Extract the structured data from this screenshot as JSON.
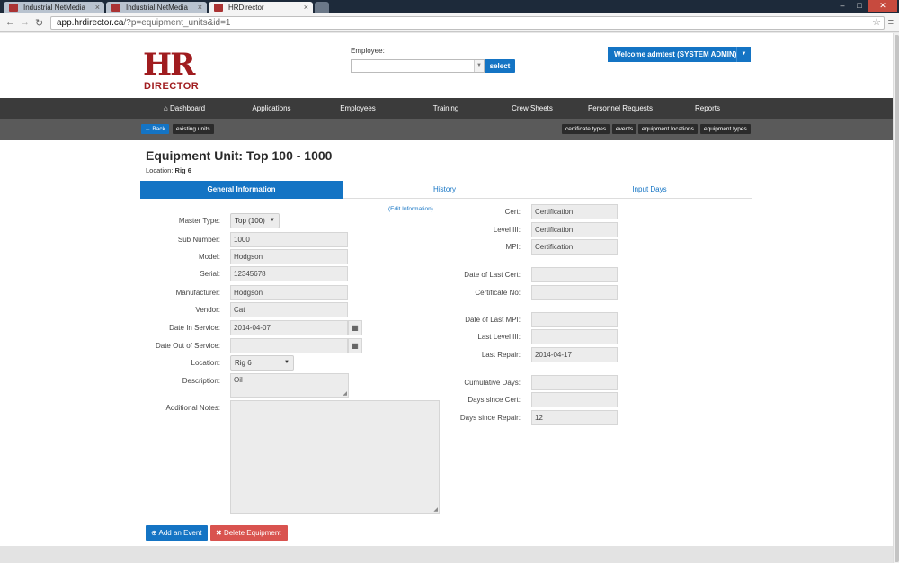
{
  "browser": {
    "tabs": [
      {
        "title": "Industrial NetMedia",
        "active": false
      },
      {
        "title": "Industrial NetMedia",
        "active": false
      },
      {
        "title": "HRDirector",
        "active": true
      }
    ],
    "url_host": "app.hrdirector.ca",
    "url_path": "/?p=equipment_units&id=1",
    "controls": {
      "minimize": "–",
      "maximize": "□",
      "close": "✕",
      "back": "←",
      "forward": "→",
      "reload": "↻",
      "star": "☆",
      "menu": "≡",
      "tab_close": "×"
    }
  },
  "header": {
    "logo_top": "HR",
    "logo_bottom": "DIRECTOR",
    "employee_label": "Employee:",
    "employee_value": "",
    "select_button": "select",
    "welcome": "Welcome admtest (SYSTEM ADMIN)"
  },
  "nav": {
    "items": [
      {
        "label": "Dashboard",
        "icon": "home-icon"
      },
      {
        "label": "Applications"
      },
      {
        "label": "Employees"
      },
      {
        "label": "Training"
      },
      {
        "label": "Crew Sheets"
      },
      {
        "label": "Personnel Requests"
      },
      {
        "label": "Reports"
      }
    ],
    "home_glyph": "⌂"
  },
  "subnav": {
    "back_label": "Back",
    "back_glyph": "←",
    "existing_units": "existing units",
    "right": [
      "certificate types",
      "events",
      "equipment locations",
      "equipment types"
    ]
  },
  "page": {
    "title": "Equipment Unit: Top 100 - 1000",
    "location_label": "Location:",
    "location_value": "Rig 6",
    "tabs": [
      "General Information",
      "History",
      "Input Days"
    ],
    "active_tab": 0,
    "edit_link": "(Edit Information)"
  },
  "form_left": {
    "master_type_label": "Master Type:",
    "master_type_value": "Top (100)",
    "sub_number_label": "Sub Number:",
    "sub_number_value": "1000",
    "model_label": "Model:",
    "model_value": "Hodgson",
    "serial_label": "Serial:",
    "serial_value": "12345678",
    "manufacturer_label": "Manufacturer:",
    "manufacturer_value": "Hodgson",
    "vendor_label": "Vendor:",
    "vendor_value": "Cat",
    "date_in_service_label": "Date In Service:",
    "date_in_service_value": "2014-04-07",
    "date_out_service_label": "Date Out of Service:",
    "date_out_service_value": "",
    "location_label": "Location:",
    "location_value": "Rig 6",
    "description_label": "Description:",
    "description_value": "Oil",
    "notes_label": "Additional Notes:",
    "notes_value": ""
  },
  "form_right": {
    "cert_label": "Cert:",
    "cert_value": "Certification",
    "level3_label": "Level III:",
    "level3_value": "Certification",
    "mpi_label": "MPI:",
    "mpi_value": "Certification",
    "last_cert_label": "Date of Last Cert:",
    "last_cert_value": "",
    "cert_no_label": "Certificate No:",
    "cert_no_value": "",
    "last_mpi_label": "Date of Last MPI:",
    "last_mpi_value": "",
    "last_level3_label": "Last Level III:",
    "last_level3_value": "",
    "last_repair_label": "Last Repair:",
    "last_repair_value": "2014-04-17",
    "cumulative_label": "Cumulative Days:",
    "cumulative_value": "",
    "since_cert_label": "Days since Cert:",
    "since_cert_value": "",
    "since_repair_label": "Days since Repair:",
    "since_repair_value": "12"
  },
  "actions": {
    "add_event": "Add an Event",
    "add_glyph": "⊕",
    "delete": "Delete Equipment",
    "delete_glyph": "✖",
    "calendar_glyph": "▦",
    "caret_glyph": "▼"
  },
  "colors": {
    "accent": "#1474c4",
    "brand": "#a01c1f",
    "danger": "#d9534f",
    "nav_bg": "#3b3b3b"
  }
}
